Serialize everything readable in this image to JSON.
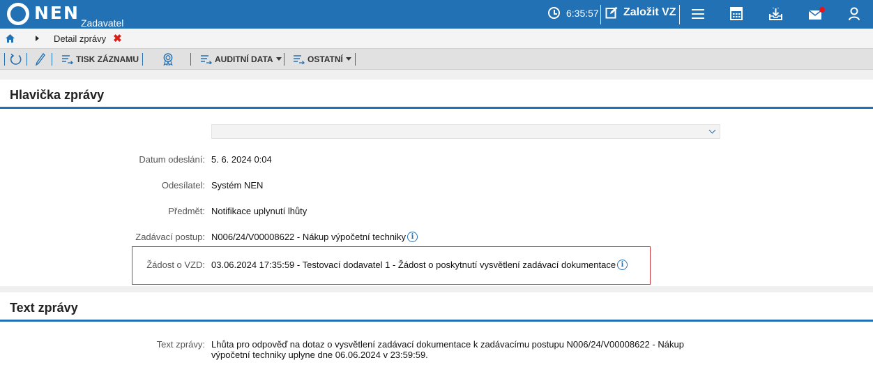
{
  "topbar": {
    "logo_text": "NEN",
    "logo_sub": "Zadavatel",
    "clock": "6:35:57",
    "create_label": "Založit VZ",
    "notification_color": "#e8141c"
  },
  "breadcrumb": {
    "current": "Detail zprávy"
  },
  "toolbar": {
    "print_label": "TISK ZÁZNAMU",
    "audit_label": "AUDITNÍ DATA",
    "other_label": "OSTATNÍ"
  },
  "header_section": {
    "title": "Hlavička zprávy",
    "select_value": "",
    "fields": {
      "sent_date": {
        "label": "Datum odeslání:",
        "value": "5. 6. 2024 0:04"
      },
      "sender": {
        "label": "Odesílatel:",
        "value": "Systém NEN"
      },
      "subject": {
        "label": "Předmět:",
        "value": "Notifikace uplynutí lhůty"
      },
      "procedure": {
        "label": "Zadávací postup:",
        "value": "N006/24/V00008622 - Nákup výpočetní techniky"
      },
      "request": {
        "label": "Žádost o VZD:",
        "value": "03.06.2024 17:35:59 - Testovací dodavatel 1 - Žádost o poskytnutí vysvětlení zadávací dokumentace"
      }
    }
  },
  "text_section": {
    "title": "Text zprávy",
    "label": "Text zprávy:",
    "line1": "Lhůta pro odpověď na dotaz o vysvětlení zadávací dokumentace k zadávacímu postupu N006/24/V00008622 - Nákup",
    "line2": "výpočetní techniky uplyne dne 06.06.2024 v 23:59:59."
  },
  "colors": {
    "brand": "#2271b5",
    "highlight_border": "#c8343a",
    "close_x": "#d6201a"
  }
}
